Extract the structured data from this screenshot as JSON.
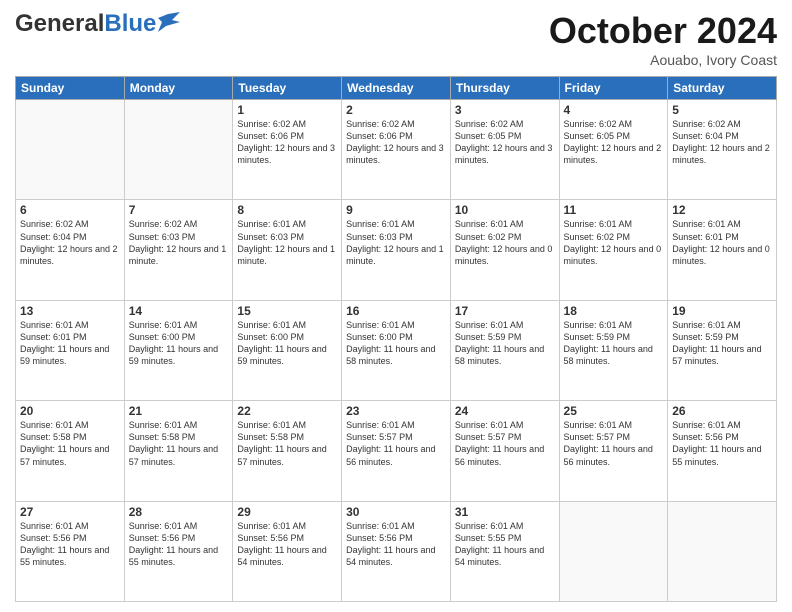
{
  "header": {
    "logo_general": "General",
    "logo_blue": "Blue",
    "month": "October 2024",
    "location": "Aouabo, Ivory Coast"
  },
  "weekdays": [
    "Sunday",
    "Monday",
    "Tuesday",
    "Wednesday",
    "Thursday",
    "Friday",
    "Saturday"
  ],
  "weeks": [
    [
      {
        "day": "",
        "info": ""
      },
      {
        "day": "",
        "info": ""
      },
      {
        "day": "1",
        "info": "Sunrise: 6:02 AM\nSunset: 6:06 PM\nDaylight: 12 hours and 3 minutes."
      },
      {
        "day": "2",
        "info": "Sunrise: 6:02 AM\nSunset: 6:06 PM\nDaylight: 12 hours and 3 minutes."
      },
      {
        "day": "3",
        "info": "Sunrise: 6:02 AM\nSunset: 6:05 PM\nDaylight: 12 hours and 3 minutes."
      },
      {
        "day": "4",
        "info": "Sunrise: 6:02 AM\nSunset: 6:05 PM\nDaylight: 12 hours and 2 minutes."
      },
      {
        "day": "5",
        "info": "Sunrise: 6:02 AM\nSunset: 6:04 PM\nDaylight: 12 hours and 2 minutes."
      }
    ],
    [
      {
        "day": "6",
        "info": "Sunrise: 6:02 AM\nSunset: 6:04 PM\nDaylight: 12 hours and 2 minutes."
      },
      {
        "day": "7",
        "info": "Sunrise: 6:02 AM\nSunset: 6:03 PM\nDaylight: 12 hours and 1 minute."
      },
      {
        "day": "8",
        "info": "Sunrise: 6:01 AM\nSunset: 6:03 PM\nDaylight: 12 hours and 1 minute."
      },
      {
        "day": "9",
        "info": "Sunrise: 6:01 AM\nSunset: 6:03 PM\nDaylight: 12 hours and 1 minute."
      },
      {
        "day": "10",
        "info": "Sunrise: 6:01 AM\nSunset: 6:02 PM\nDaylight: 12 hours and 0 minutes."
      },
      {
        "day": "11",
        "info": "Sunrise: 6:01 AM\nSunset: 6:02 PM\nDaylight: 12 hours and 0 minutes."
      },
      {
        "day": "12",
        "info": "Sunrise: 6:01 AM\nSunset: 6:01 PM\nDaylight: 12 hours and 0 minutes."
      }
    ],
    [
      {
        "day": "13",
        "info": "Sunrise: 6:01 AM\nSunset: 6:01 PM\nDaylight: 11 hours and 59 minutes."
      },
      {
        "day": "14",
        "info": "Sunrise: 6:01 AM\nSunset: 6:00 PM\nDaylight: 11 hours and 59 minutes."
      },
      {
        "day": "15",
        "info": "Sunrise: 6:01 AM\nSunset: 6:00 PM\nDaylight: 11 hours and 59 minutes."
      },
      {
        "day": "16",
        "info": "Sunrise: 6:01 AM\nSunset: 6:00 PM\nDaylight: 11 hours and 58 minutes."
      },
      {
        "day": "17",
        "info": "Sunrise: 6:01 AM\nSunset: 5:59 PM\nDaylight: 11 hours and 58 minutes."
      },
      {
        "day": "18",
        "info": "Sunrise: 6:01 AM\nSunset: 5:59 PM\nDaylight: 11 hours and 58 minutes."
      },
      {
        "day": "19",
        "info": "Sunrise: 6:01 AM\nSunset: 5:59 PM\nDaylight: 11 hours and 57 minutes."
      }
    ],
    [
      {
        "day": "20",
        "info": "Sunrise: 6:01 AM\nSunset: 5:58 PM\nDaylight: 11 hours and 57 minutes."
      },
      {
        "day": "21",
        "info": "Sunrise: 6:01 AM\nSunset: 5:58 PM\nDaylight: 11 hours and 57 minutes."
      },
      {
        "day": "22",
        "info": "Sunrise: 6:01 AM\nSunset: 5:58 PM\nDaylight: 11 hours and 57 minutes."
      },
      {
        "day": "23",
        "info": "Sunrise: 6:01 AM\nSunset: 5:57 PM\nDaylight: 11 hours and 56 minutes."
      },
      {
        "day": "24",
        "info": "Sunrise: 6:01 AM\nSunset: 5:57 PM\nDaylight: 11 hours and 56 minutes."
      },
      {
        "day": "25",
        "info": "Sunrise: 6:01 AM\nSunset: 5:57 PM\nDaylight: 11 hours and 56 minutes."
      },
      {
        "day": "26",
        "info": "Sunrise: 6:01 AM\nSunset: 5:56 PM\nDaylight: 11 hours and 55 minutes."
      }
    ],
    [
      {
        "day": "27",
        "info": "Sunrise: 6:01 AM\nSunset: 5:56 PM\nDaylight: 11 hours and 55 minutes."
      },
      {
        "day": "28",
        "info": "Sunrise: 6:01 AM\nSunset: 5:56 PM\nDaylight: 11 hours and 55 minutes."
      },
      {
        "day": "29",
        "info": "Sunrise: 6:01 AM\nSunset: 5:56 PM\nDaylight: 11 hours and 54 minutes."
      },
      {
        "day": "30",
        "info": "Sunrise: 6:01 AM\nSunset: 5:56 PM\nDaylight: 11 hours and 54 minutes."
      },
      {
        "day": "31",
        "info": "Sunrise: 6:01 AM\nSunset: 5:55 PM\nDaylight: 11 hours and 54 minutes."
      },
      {
        "day": "",
        "info": ""
      },
      {
        "day": "",
        "info": ""
      }
    ]
  ]
}
